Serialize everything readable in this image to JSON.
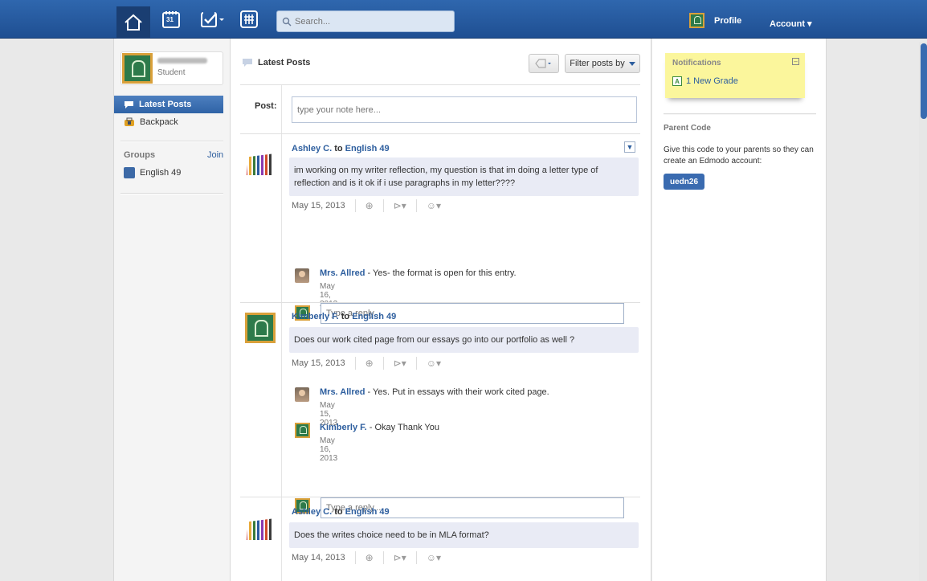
{
  "topbar": {
    "search_placeholder": "Search...",
    "calendar_day": "31",
    "profile_label": "Profile",
    "account_label": "Account ▾"
  },
  "sidebar": {
    "user_role": "Student",
    "active_item": "Latest Posts",
    "items": [
      {
        "label": "Backpack"
      }
    ],
    "groups_header": "Groups",
    "join_label": "Join",
    "groups": [
      {
        "label": "English 49",
        "color": "#3c69a6"
      }
    ]
  },
  "main": {
    "header_title": "Latest Posts",
    "filter_label": "Filter posts by",
    "post_label": "Post:",
    "post_placeholder": "type your note here...",
    "reply_placeholder": "Type a reply...",
    "posts": [
      {
        "author": "Ashley C.",
        "to": " to ",
        "group": "English 49",
        "body": "im working on my writer reflection, my question is that im doing a letter type of reflection and is it ok if i use paragraphs in my letter????",
        "date": "May 15, 2013",
        "replies": [
          {
            "author": "Mrs. Allred",
            "text": " - Yes- the format is open for this entry.",
            "date": "May 16, 2013"
          }
        ]
      },
      {
        "author": "Kimberly F.",
        "to": " to ",
        "group": "English 49",
        "body": "Does our work cited page from our essays go into our portfolio as well ?",
        "date": "May 15, 2013",
        "replies": [
          {
            "author": "Mrs. Allred",
            "text": " - Yes. Put in essays with their work cited page.",
            "date": "May 15, 2013"
          },
          {
            "author": "Kimberly F.",
            "text": " - Okay Thank You",
            "date": "May 16, 2013"
          }
        ]
      },
      {
        "author": "Ashley C.",
        "to": " to ",
        "group": "English 49",
        "body": "Does the writes choice need to be in MLA format?",
        "date": "May 14, 2013",
        "replies": []
      }
    ]
  },
  "rightbar": {
    "notifications_title": "Notifications",
    "notification_item": "1 New Grade",
    "parent_code_title": "Parent Code",
    "parent_code_desc": "Give this code to your parents so they can create an Edmodo account:",
    "parent_code": "uedn26"
  },
  "colors": {
    "topbar": "#2f67ae",
    "link": "#2d5e9e",
    "notification_bg": "#fbf69c"
  }
}
